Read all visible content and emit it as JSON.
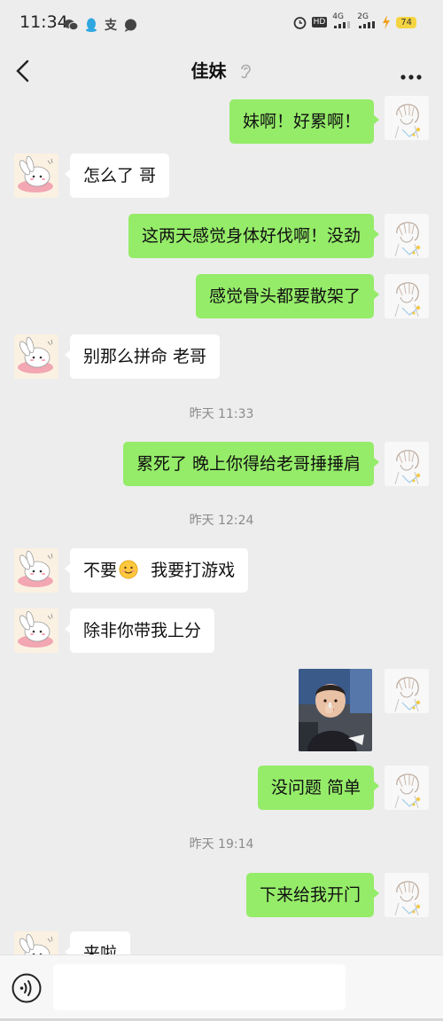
{
  "status_bar": {
    "time": "11:34",
    "left_icons": [
      "wechat-icon",
      "qq-icon",
      "alipay-icon",
      "message-icon"
    ],
    "right_icons": [
      "alarm-icon",
      "hd-icon",
      "signal-4g-icon",
      "signal-2g-icon",
      "charging-icon"
    ],
    "network_1": "4G",
    "network_2": "2G",
    "hd": "HD",
    "battery": "74"
  },
  "header": {
    "title": "佳妹",
    "icons": [
      "back-arrow-icon",
      "ear-icon",
      "more-icon"
    ]
  },
  "messages": [
    {
      "sender": "me",
      "text": "妹啊！好累啊！"
    },
    {
      "sender": "other",
      "text": "怎么了 哥"
    },
    {
      "sender": "me",
      "text": "这两天感觉身体好伐啊！没劲"
    },
    {
      "sender": "me",
      "text": "感觉骨头都要散架了"
    },
    {
      "sender": "other",
      "text": "别那么拼命  老哥"
    },
    {
      "timestamp": "昨天 11:33"
    },
    {
      "sender": "me",
      "text": "累死了  晚上你得给老哥捶捶肩"
    },
    {
      "timestamp": "昨天 12:24"
    },
    {
      "sender": "other",
      "text_before": "不要",
      "emoji": "smile-emoji",
      "text_after": "  我要打游戏"
    },
    {
      "sender": "other",
      "text": "除非你带我上分"
    },
    {
      "sender": "me",
      "type": "image",
      "image": "photo-of-child"
    },
    {
      "sender": "me",
      "text": "没问题  简单"
    },
    {
      "timestamp": "昨天 19:14"
    },
    {
      "sender": "me",
      "text": "下来给我开门"
    },
    {
      "sender": "other",
      "text": "来啦"
    }
  ],
  "input_bar": {
    "value": "",
    "placeholder": "",
    "icons": [
      "voice-icon"
    ]
  },
  "colors": {
    "background": "#ededed",
    "my_bubble": "#95ec69",
    "other_bubble": "#ffffff"
  }
}
